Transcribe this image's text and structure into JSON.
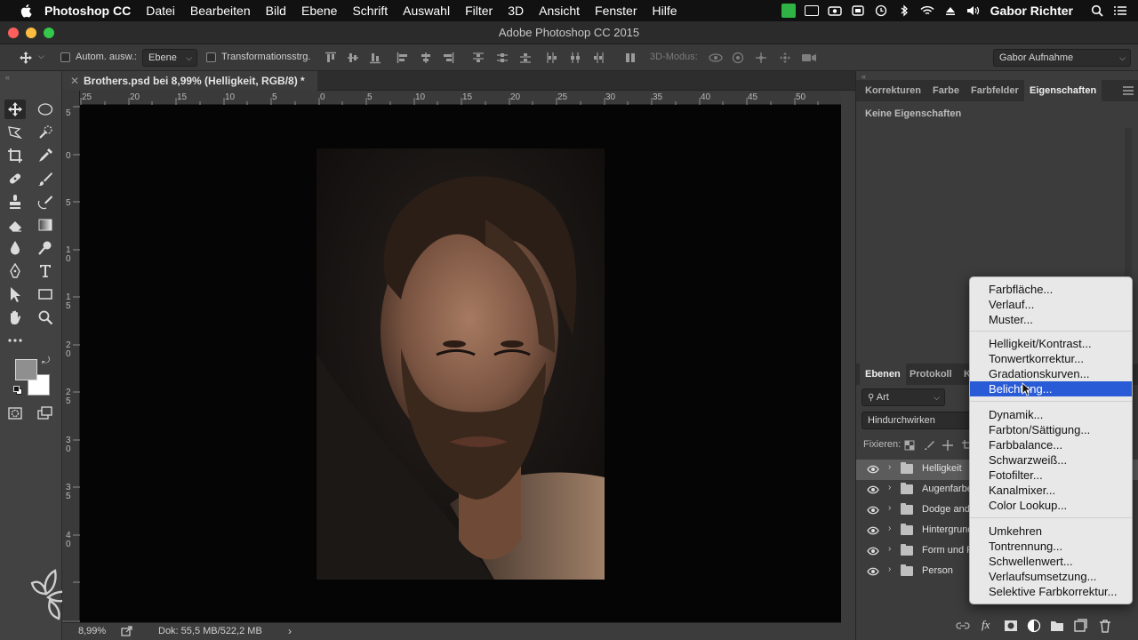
{
  "menubar": {
    "app": "Photoshop CC",
    "items": [
      "Datei",
      "Bearbeiten",
      "Bild",
      "Ebene",
      "Schrift",
      "Auswahl",
      "Filter",
      "3D",
      "Ansicht",
      "Fenster",
      "Hilfe"
    ],
    "user": "Gabor Richter"
  },
  "window": {
    "title": "Adobe Photoshop CC 2015"
  },
  "options": {
    "auto_select_label": "Autom. ausw.:",
    "auto_select_value": "Ebene",
    "transform_label": "Transformationsstrg.",
    "mode3d_label": "3D-Modus:",
    "workspace": "Gabor Aufnahme"
  },
  "document": {
    "tab_title": "Brothers.psd bei 8,99% (Helligkeit, RGB/8) *",
    "zoom": "8,99%",
    "doc_info": "Dok: 55,5 MB/522,2 MB",
    "h_ruler": [
      "25",
      "20",
      "15",
      "10",
      "5",
      "0",
      "5",
      "10",
      "15",
      "20",
      "25",
      "30",
      "35",
      "40",
      "45",
      "50"
    ],
    "v_ruler": [
      "5",
      "0",
      "5",
      "10",
      "15",
      "20",
      "25",
      "30",
      "35",
      "40"
    ]
  },
  "panels": {
    "top_tabs": [
      "Korrekturen",
      "Farbe",
      "Farbfelder",
      "Eigenschaften"
    ],
    "properties_empty": "Keine Eigenschaften",
    "layers_tabs": [
      "Ebenen",
      "Protokoll",
      "K"
    ],
    "filter_kind": "Art",
    "blend_mode": "Hindurchwirken",
    "lock_label": "Fixieren:",
    "layers": [
      {
        "name": "Helligkeit",
        "selected": true
      },
      {
        "name": "Augenfarbe",
        "selected": false
      },
      {
        "name": "Dodge and",
        "selected": false
      },
      {
        "name": "Hintergrund",
        "selected": false
      },
      {
        "name": "Form und F",
        "selected": false
      },
      {
        "name": "Person",
        "selected": false
      }
    ]
  },
  "context_menu": {
    "groups": [
      [
        "Farbfläche...",
        "Verlauf...",
        "Muster..."
      ],
      [
        "Helligkeit/Kontrast...",
        "Tonwertkorrektur...",
        "Gradationskurven...",
        "Belichtung..."
      ],
      [
        "Dynamik...",
        "Farbton/Sättigung...",
        "Farbbalance...",
        "Schwarzweiß...",
        "Fotofilter...",
        "Kanalmixer...",
        "Color Lookup..."
      ],
      [
        "Umkehren",
        "Tontrennung...",
        "Schwellenwert...",
        "Verlaufsumsetzung...",
        "Selektive Farbkorrektur..."
      ]
    ],
    "highlighted": "Belichtung..."
  },
  "colors": {
    "accent_highlight": "#2a5bd7",
    "foreground_swatch": "#8f8f8f",
    "background_swatch": "#ffffff"
  }
}
